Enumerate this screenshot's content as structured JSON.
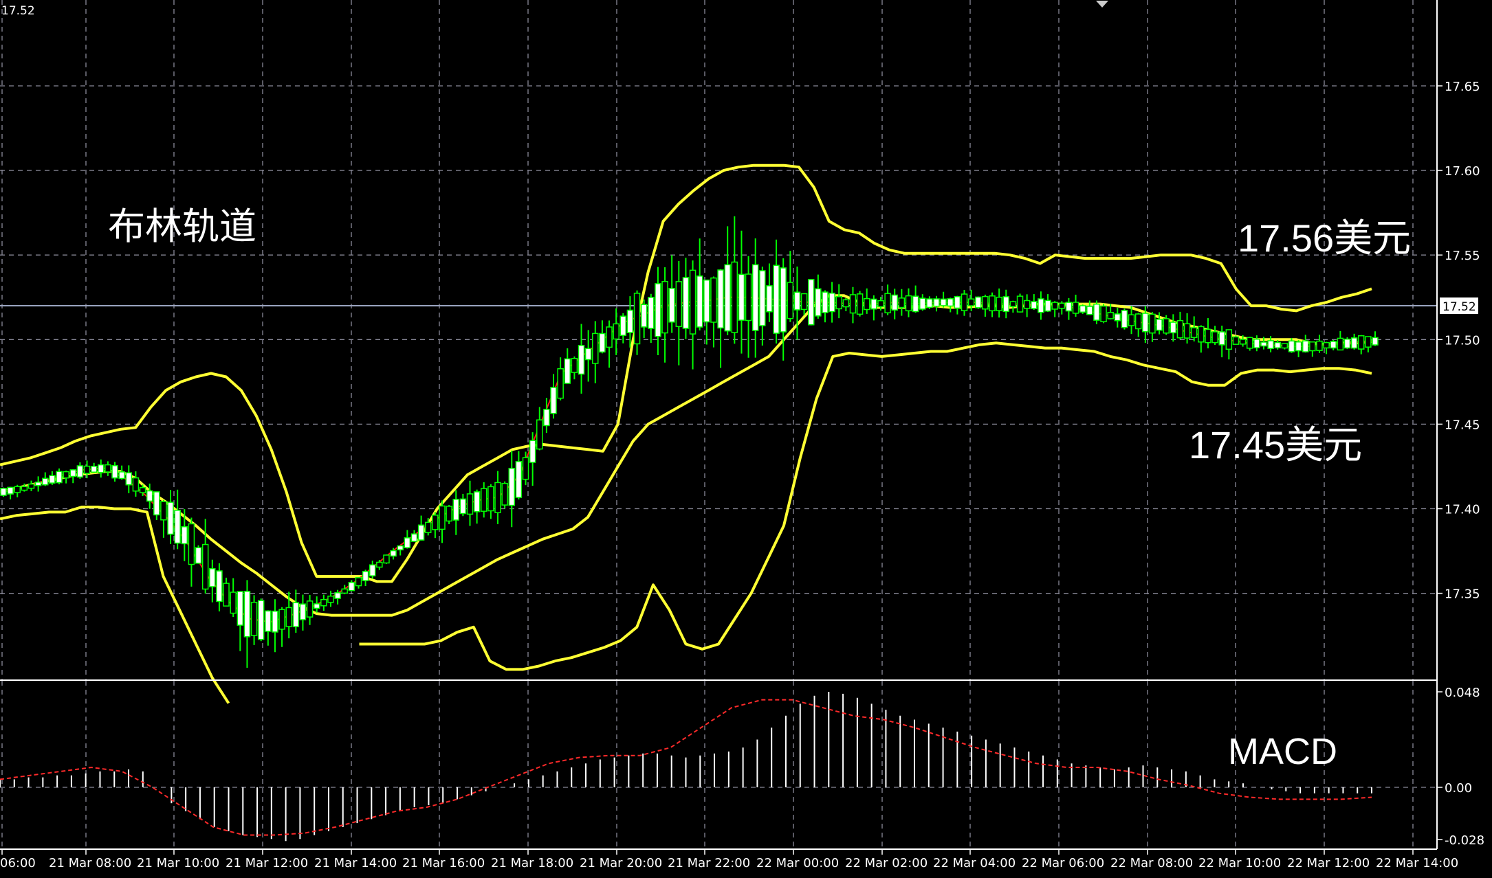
{
  "chart_data": [
    {
      "type": "candlestick",
      "title": "",
      "ylabel": "",
      "x_tick_labels": [
        "06:00",
        "21 Mar 08:00",
        "21 Mar 10:00",
        "21 Mar 12:00",
        "21 Mar 14:00",
        "21 Mar 16:00",
        "21 Mar 18:00",
        "21 Mar 20:00",
        "21 Mar 22:00",
        "22 Mar 00:00",
        "22 Mar 02:00",
        "22 Mar 04:00",
        "22 Mar 06:00",
        "22 Mar 08:00",
        "22 Mar 10:00",
        "22 Mar 12:00",
        "22 Mar 14:00"
      ],
      "y_tick_labels": [
        "17.65",
        "17.60",
        "17.55",
        "17.50",
        "17.45",
        "17.40",
        "17.35"
      ],
      "ylim": [
        17.297,
        17.7
      ],
      "top_left_value": "17.52",
      "current_price": {
        "label": "17.52",
        "value": 17.52
      },
      "annotations": {
        "chart_name": "布林轨道",
        "resistance": "17.56美元",
        "support": "17.45美元"
      },
      "colors": {
        "candle": "#00ff00",
        "bull_body": "#000000",
        "bear_body": "#ffffff",
        "bollinger": "#ffff33",
        "ma": "#ff1a1a",
        "grid": "#8a8a99",
        "price_line": "#9aa4bf"
      },
      "series": [
        {
          "role": "bollinger_upper",
          "values": [
            17.426,
            17.428,
            17.43,
            17.433,
            17.436,
            17.44,
            17.443,
            17.445,
            17.447,
            17.448,
            17.46,
            17.47,
            17.475,
            17.478,
            17.48,
            17.478,
            17.47,
            17.455,
            17.435,
            17.41,
            17.38,
            17.36,
            17.36,
            17.36,
            17.36,
            17.357,
            17.357,
            17.37,
            17.385,
            17.4,
            17.41,
            17.42,
            17.425,
            17.43,
            17.435,
            17.437,
            17.438,
            17.437,
            17.436,
            17.435,
            17.434,
            17.45,
            17.5,
            17.54,
            17.57,
            17.58,
            17.588,
            17.595,
            17.6,
            17.602,
            17.603,
            17.603,
            17.603,
            17.602,
            17.59,
            17.57,
            17.565,
            17.563,
            17.557,
            17.553,
            17.551,
            17.551,
            17.551,
            17.551,
            17.551,
            17.551,
            17.551,
            17.55,
            17.548,
            17.545,
            17.55,
            17.549,
            17.548,
            17.548,
            17.548,
            17.548,
            17.549,
            17.55,
            17.55,
            17.55,
            17.548,
            17.545,
            17.53,
            17.52,
            17.52,
            17.518,
            17.517,
            17.52,
            17.522,
            17.525,
            17.527,
            17.53
          ]
        },
        {
          "role": "bollinger_middle",
          "values": [
            17.41,
            17.412,
            17.414,
            17.416,
            17.418,
            17.42,
            17.421,
            17.422,
            17.422,
            17.418,
            17.41,
            17.404,
            17.397,
            17.39,
            17.382,
            17.375,
            17.368,
            17.362,
            17.355,
            17.348,
            17.342,
            17.338,
            17.337,
            17.337,
            17.337,
            17.337,
            17.337,
            17.34,
            17.345,
            17.35,
            17.355,
            17.36,
            17.365,
            17.37,
            17.374,
            17.378,
            17.382,
            17.385,
            17.388,
            17.395,
            17.41,
            17.425,
            17.44,
            17.45,
            17.455,
            17.46,
            17.465,
            17.47,
            17.475,
            17.48,
            17.485,
            17.49,
            17.5,
            17.51,
            17.52,
            17.526,
            17.526,
            17.522,
            17.519,
            17.519,
            17.519,
            17.519,
            17.52,
            17.519,
            17.519,
            17.52,
            17.52,
            17.519,
            17.52,
            17.521,
            17.521,
            17.521,
            17.521,
            17.521,
            17.52,
            17.519,
            17.516,
            17.513,
            17.51,
            17.508,
            17.506,
            17.504,
            17.502,
            17.5,
            17.5,
            17.5,
            17.5,
            17.498,
            17.497,
            17.498,
            17.498,
            17.499
          ]
        },
        {
          "role": "bollinger_lower",
          "values": [
            17.394,
            17.396,
            17.397,
            17.398,
            17.398,
            17.401,
            17.401,
            17.4,
            17.4,
            17.398,
            17.36,
            17.34,
            17.32,
            17.3,
            17.285,
            null,
            null,
            null,
            null,
            null,
            null,
            null,
            17.32,
            17.32,
            17.32,
            17.32,
            17.32,
            17.322,
            17.327,
            17.33,
            17.31,
            17.305,
            17.305,
            17.307,
            17.31,
            17.312,
            17.315,
            17.318,
            17.322,
            17.33,
            17.355,
            17.34,
            17.32,
            17.317,
            17.32,
            17.335,
            17.35,
            17.37,
            17.39,
            17.43,
            17.465,
            17.49,
            17.492,
            17.491,
            17.49,
            17.491,
            17.492,
            17.493,
            17.493,
            17.495,
            17.497,
            17.498,
            17.497,
            17.496,
            17.495,
            17.495,
            17.494,
            17.493,
            17.49,
            17.488,
            17.485,
            17.483,
            17.481,
            17.475,
            17.473,
            17.473,
            17.48,
            17.482,
            17.482,
            17.481,
            17.482,
            17.483,
            17.483,
            17.482,
            17.48
          ]
        },
        {
          "role": "moving_average",
          "values": [
            17.41,
            17.412,
            17.416,
            17.42,
            17.423,
            17.424,
            17.418,
            17.408,
            17.395,
            17.38,
            17.36,
            17.345,
            17.335,
            17.333,
            17.337,
            17.342,
            17.348,
            17.356,
            17.366,
            17.376,
            17.385,
            17.394,
            17.401,
            17.405,
            17.407,
            17.42,
            17.45,
            17.48,
            17.49,
            17.5,
            17.51,
            17.515,
            17.52,
            17.522,
            17.523,
            17.525,
            17.525,
            17.524,
            17.523,
            17.522,
            17.522,
            17.521,
            17.521,
            17.522,
            17.521,
            17.522,
            17.522,
            17.522,
            17.521,
            17.521,
            17.52,
            17.52,
            17.518,
            17.515,
            17.512,
            17.51,
            17.508,
            17.505,
            17.502,
            17.5,
            17.498,
            17.497,
            17.496,
            17.496,
            17.497,
            17.498,
            17.499
          ]
        }
      ]
    },
    {
      "type": "bar",
      "title": "MACD",
      "y_tick_labels": [
        "0.048",
        "0.00",
        "-0.028"
      ],
      "ylim": [
        -0.03,
        0.05
      ],
      "colors": {
        "histogram": "#ffffff",
        "signal": "#ff2a2a"
      },
      "series": [
        {
          "name": "MACD",
          "role": "histogram",
          "values": [
            0.004,
            0.004,
            0.005,
            0.005,
            0.006,
            0.006,
            0.007,
            0.008,
            0.008,
            0.009,
            0.008,
            0.0,
            -0.008,
            -0.012,
            -0.016,
            -0.02,
            -0.022,
            -0.024,
            -0.025,
            -0.026,
            -0.027,
            -0.026,
            -0.024,
            -0.022,
            -0.02,
            -0.018,
            -0.016,
            -0.014,
            -0.012,
            -0.01,
            -0.009,
            -0.008,
            -0.006,
            -0.004,
            -0.002,
            0.0,
            0.002,
            0.004,
            0.006,
            0.008,
            0.01,
            0.012,
            0.014,
            0.015,
            0.016,
            0.017,
            0.017,
            0.016,
            0.015,
            0.016,
            0.017,
            0.018,
            0.02,
            0.024,
            0.03,
            0.036,
            0.042,
            0.046,
            0.048,
            0.047,
            0.045,
            0.042,
            0.039,
            0.036,
            0.034,
            0.032,
            0.03,
            0.028,
            0.026,
            0.024,
            0.022,
            0.02,
            0.018,
            0.016,
            0.014,
            0.012,
            0.011,
            0.01,
            0.009,
            0.01,
            0.011,
            0.01,
            0.009,
            0.008,
            0.006,
            0.004,
            0.003,
            0.002,
            0.0,
            -0.001,
            -0.002,
            -0.003,
            -0.003,
            -0.003,
            -0.003,
            -0.003,
            -0.003
          ]
        },
        {
          "role": "signal",
          "values": [
            0.004,
            0.006,
            0.008,
            0.01,
            0.008,
            0.0,
            -0.01,
            -0.02,
            -0.024,
            -0.024,
            -0.023,
            -0.02,
            -0.016,
            -0.012,
            -0.01,
            -0.006,
            0.0,
            0.006,
            0.012,
            0.015,
            0.016,
            0.016,
            0.02,
            0.03,
            0.04,
            0.044,
            0.044,
            0.04,
            0.036,
            0.034,
            0.03,
            0.025,
            0.02,
            0.016,
            0.012,
            0.01,
            0.01,
            0.008,
            0.004,
            0.001,
            -0.003,
            -0.005,
            -0.006,
            -0.006,
            -0.006,
            -0.005
          ]
        }
      ]
    }
  ]
}
